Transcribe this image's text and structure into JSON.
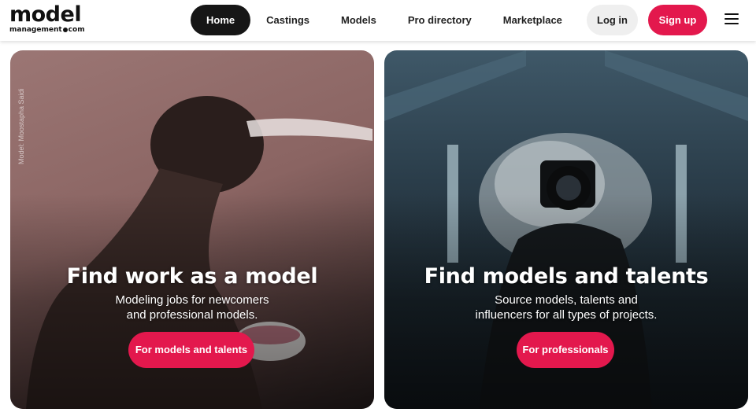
{
  "logo": {
    "main": "model",
    "sub_left": "management",
    "sub_right": "com"
  },
  "nav": [
    {
      "label": "Home",
      "active": true
    },
    {
      "label": "Castings",
      "active": false
    },
    {
      "label": "Models",
      "active": false
    },
    {
      "label": "Pro directory",
      "active": false
    },
    {
      "label": "Marketplace",
      "active": false
    }
  ],
  "auth": {
    "login": "Log in",
    "signup": "Sign up"
  },
  "menu_icon": "hamburger-icon",
  "colors": {
    "accent": "#e3184d",
    "nav_active_bg": "#161616",
    "login_bg": "#efefef"
  },
  "cards": [
    {
      "title": "Find work as a model",
      "subtitle_line1": "Modeling jobs for newcomers",
      "subtitle_line2": "and professional models.",
      "button": "For models and talents",
      "credit": "Model: Moostapha Saidi"
    },
    {
      "title": "Find models and talents",
      "subtitle_line1": "Source models, talents and",
      "subtitle_line2": "influencers for all types of projects.",
      "button": "For professionals"
    }
  ]
}
